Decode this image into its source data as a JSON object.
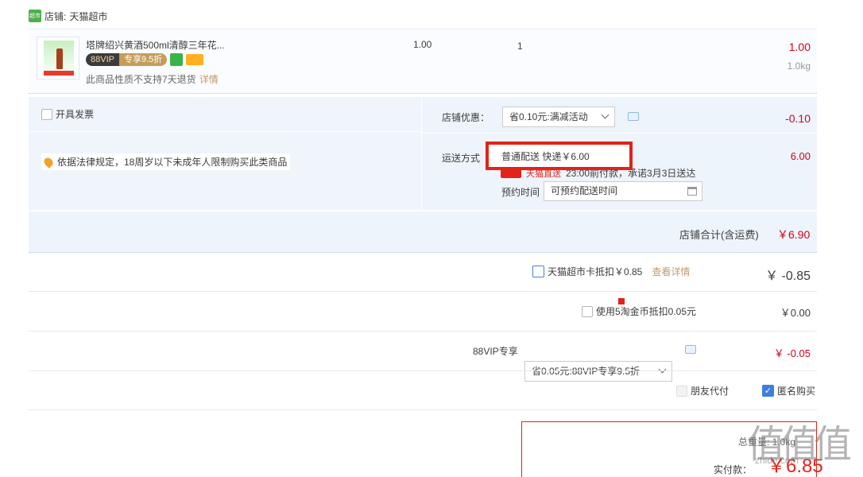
{
  "shop": {
    "label": "店铺:",
    "name": "天猫超市",
    "logo_text": "超市"
  },
  "item": {
    "name": "塔牌绍兴黄酒500ml清醇三年花...",
    "vip_tag": "88VIP",
    "vip_discount": "专享9.5折",
    "no_return": "此商品性质不支持7天退货",
    "detail_link": "详情",
    "unit_price": "1.00",
    "quantity": "1",
    "subtotal": "1.00",
    "weight": "1.0kg"
  },
  "invoice": {
    "label": "开具发票"
  },
  "law_notice": "依据法律规定，18周岁以下未成年人限制购买此类商品",
  "shop_discount": {
    "label": "店铺优惠：",
    "selected": "省0.10元:满减活动",
    "value": "-0.10"
  },
  "shipping": {
    "label": "运送方式",
    "selected": "普通配送 快递￥6.00",
    "value": "6.00",
    "tmall_text": "天猫直送",
    "promise": "23:00前付款，承诺3月3日送达",
    "appointment_label": "预约时间",
    "appointment_placeholder": "可预约配送时间"
  },
  "shop_total": {
    "label": "店铺合计(含运费)",
    "value": "￥6.90"
  },
  "card": {
    "label": "天猫超市卡抵扣￥0.85",
    "link": "查看详情",
    "value": "￥ -0.85"
  },
  "coins": {
    "label": "使用5淘金币抵扣0.05元",
    "value": "￥0.00"
  },
  "vip": {
    "label": "88VIP专享",
    "selected": "省0.05元:88VIP专享9.5折",
    "value": "￥ -0.05"
  },
  "options": {
    "friend_pay": "朋友代付",
    "anonymous": "匿名购买",
    "anonymous_check": "✓"
  },
  "summary": {
    "weight": "总重量: 1.0kg",
    "pay_label": "实付款：",
    "pay_value": "￥6.85"
  },
  "watermark": {
    "mark": "值值值",
    "url": "zhide.com"
  },
  "colors": {
    "accent_red": "#e2231a",
    "price_red": "#d0021b",
    "link_gold": "#c19a6b",
    "panel_blue": "#eef4fb"
  }
}
